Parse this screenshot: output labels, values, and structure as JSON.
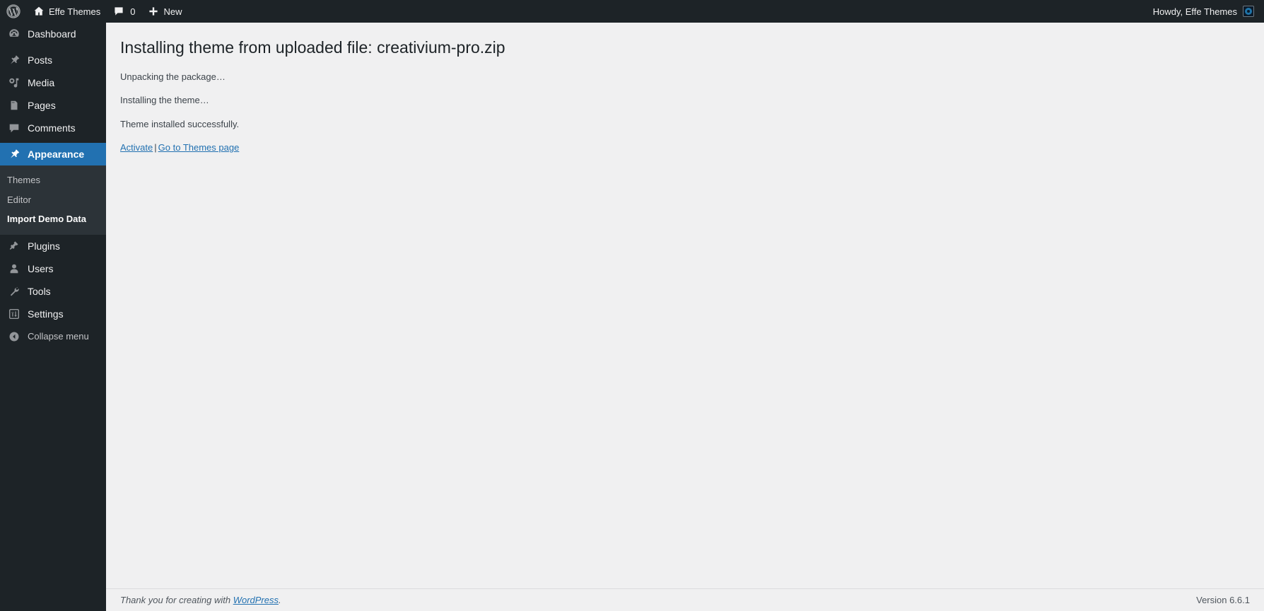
{
  "admin_bar": {
    "wp_logo_label": "wordpress-logo",
    "site_name": "Effe Themes",
    "home_icon": "home-icon",
    "comments_icon": "comment-bubble-icon",
    "comments_count": "0",
    "new_icon": "plus-icon",
    "new_label": "New",
    "howdy": "Howdy, Effe Themes",
    "avatar_label": "user-avatar"
  },
  "sidebar": {
    "items": [
      {
        "label": "Dashboard",
        "icon": "dashboard-icon",
        "state": "normal"
      },
      {
        "label": "Posts",
        "icon": "pin-icon",
        "state": "normal"
      },
      {
        "label": "Media",
        "icon": "media-icon",
        "state": "normal"
      },
      {
        "label": "Pages",
        "icon": "pages-icon",
        "state": "normal"
      },
      {
        "label": "Comments",
        "icon": "comment-bubble-icon",
        "state": "normal"
      },
      {
        "label": "Appearance",
        "icon": "paintbrush-icon",
        "state": "current"
      },
      {
        "label": "Plugins",
        "icon": "plug-icon",
        "state": "normal"
      },
      {
        "label": "Users",
        "icon": "user-icon",
        "state": "normal"
      },
      {
        "label": "Tools",
        "icon": "wrench-icon",
        "state": "normal"
      },
      {
        "label": "Settings",
        "icon": "sliders-icon",
        "state": "normal"
      }
    ],
    "appearance_submenu": [
      {
        "label": "Themes",
        "state": "normal"
      },
      {
        "label": "Editor",
        "state": "normal"
      },
      {
        "label": "Import Demo Data",
        "state": "current"
      }
    ],
    "collapse": {
      "label": "Collapse menu",
      "icon": "chevron-left-circle-icon"
    }
  },
  "main": {
    "title": "Installing theme from uploaded file: creativium-pro.zip",
    "steps": [
      "Unpacking the package…",
      "Installing the theme…",
      "Theme installed successfully."
    ],
    "actions": {
      "activate_label": "Activate",
      "separator": "|",
      "themes_page_label": "Go to Themes page"
    }
  },
  "footer": {
    "thanks_prefix": "Thank you for creating with ",
    "wordpress_link": "WordPress",
    "thanks_suffix": ".",
    "version": "Version 6.6.1"
  },
  "colors": {
    "admin_dark": "#1d2327",
    "submenu_dark": "#2c3338",
    "accent_blue": "#2271b1",
    "link_blue": "#2271b1",
    "content_bg": "#f0f0f1"
  }
}
